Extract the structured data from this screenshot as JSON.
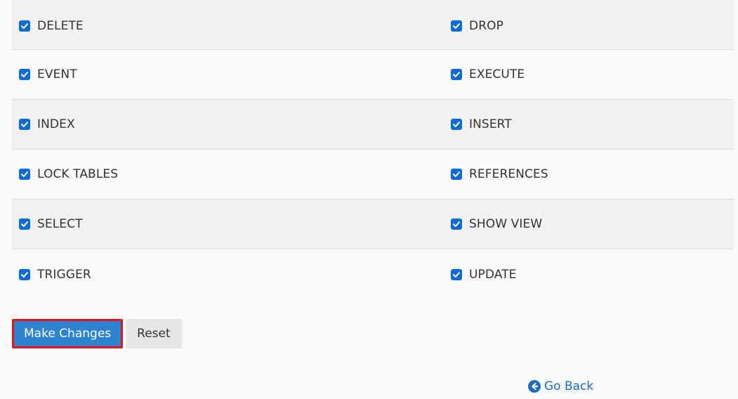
{
  "privileges": [
    {
      "left": "DELETE",
      "right": "DROP"
    },
    {
      "left": "EVENT",
      "right": "EXECUTE"
    },
    {
      "left": "INDEX",
      "right": "INSERT"
    },
    {
      "left": "LOCK TABLES",
      "right": "REFERENCES"
    },
    {
      "left": "SELECT",
      "right": "SHOW VIEW"
    },
    {
      "left": "TRIGGER",
      "right": "UPDATE"
    }
  ],
  "checked": true,
  "actions": {
    "make_changes_label": "Make Changes",
    "reset_label": "Reset"
  },
  "go_back": {
    "label": "Go Back",
    "icon": "circle-arrow-left-icon"
  },
  "colors": {
    "checkbox": "#0d6bd6",
    "primary_button": "#2e83d0",
    "highlight_border": "#e3151a",
    "link": "#1c6fc4"
  }
}
